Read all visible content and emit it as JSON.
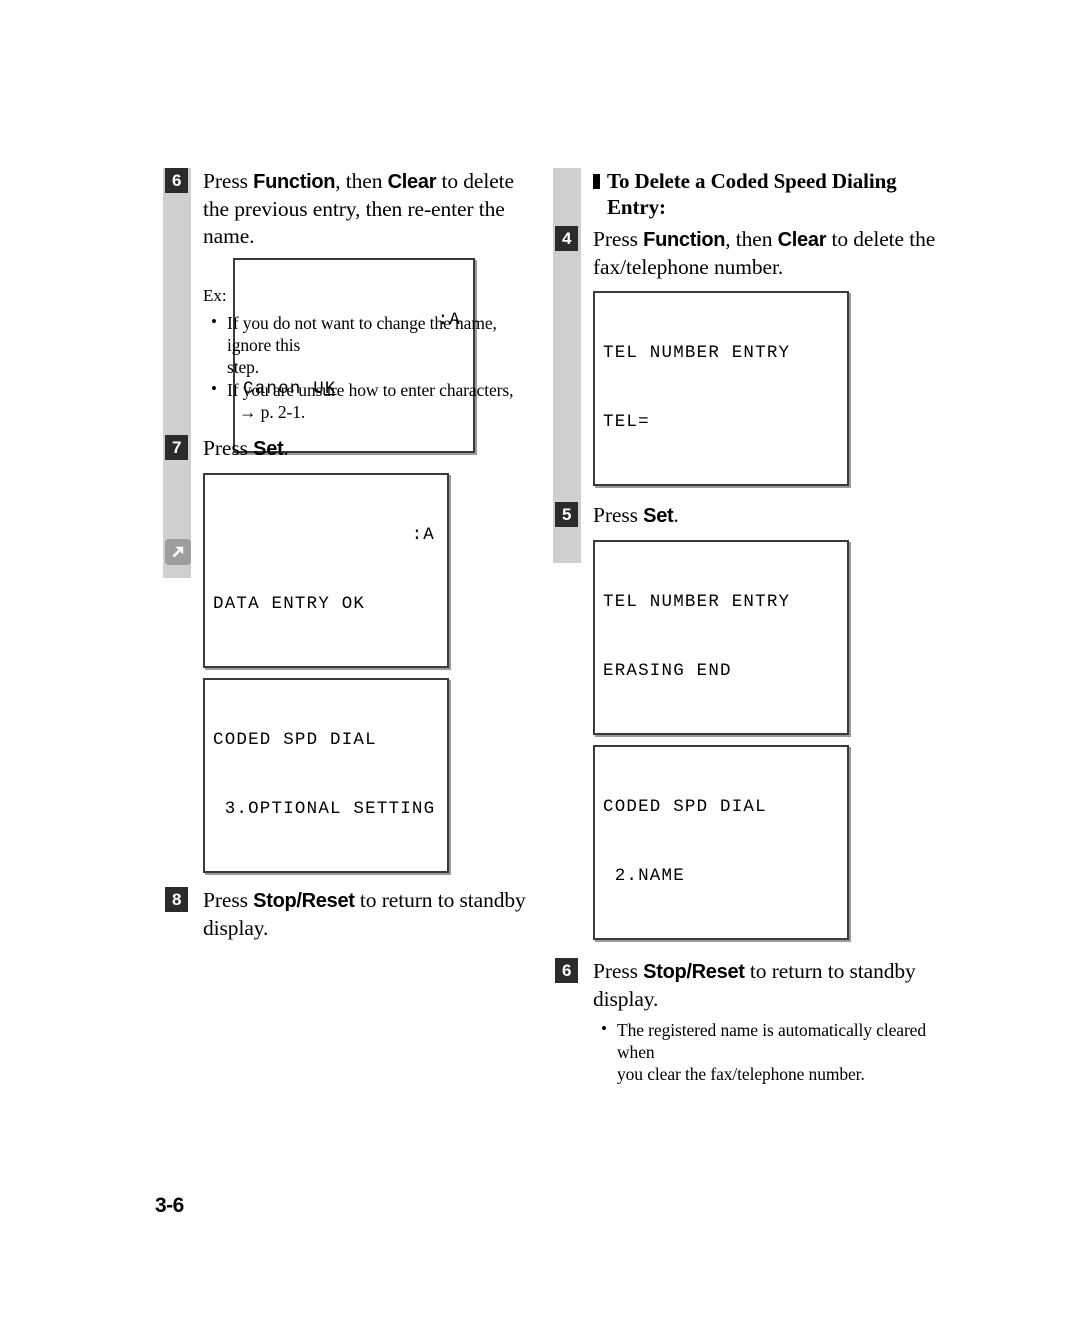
{
  "page": {
    "folio": "3-6"
  },
  "icons": {
    "jump_arrow": "arrow-up-right-icon"
  },
  "left_column": {
    "steps": [
      {
        "number": "6",
        "text_parts": {
          "t1": "Press ",
          "b1": "Function",
          "t2": ", then ",
          "b2": "Clear",
          "t3": " to delete the previous entry, then re-enter the name."
        },
        "example_label": "Ex:",
        "display": {
          "line1_right": ":A",
          "line2_prefix": "Canon U",
          "line2_cursor": "K"
        },
        "bullets": [
          {
            "line1": "If you do not want to change the name, ignore this",
            "line2": "step."
          },
          {
            "line1": "If you are unsure how to enter characters,",
            "line2": "→ p. 2-1."
          }
        ]
      },
      {
        "number": "7",
        "text_parts": {
          "t1": "Press ",
          "b1": "Set",
          "t2": "."
        },
        "display_1": {
          "line1_right": ":A",
          "line2": "DATA ENTRY OK"
        },
        "display_2": {
          "line1": "CODED SPD DIAL",
          "line2": " 3.OPTIONAL SETTING"
        }
      },
      {
        "number": "8",
        "text_parts": {
          "t1": "Press ",
          "b1": "Stop/Reset",
          "t2": " to return to standby display."
        }
      }
    ]
  },
  "right_column": {
    "heading": {
      "line1": "To Delete a Coded Speed Dialing",
      "line2": "Entry:"
    },
    "steps": [
      {
        "number": "4",
        "text_parts": {
          "t1": "Press ",
          "b1": "Function",
          "t2": ", then ",
          "b2": "Clear",
          "t3": " to delete the fax/telephone number."
        },
        "display": {
          "line1": "TEL NUMBER ENTRY",
          "line2": "TEL="
        }
      },
      {
        "number": "5",
        "text_parts": {
          "t1": "Press ",
          "b1": "Set",
          "t2": "."
        },
        "display_1": {
          "line1": "TEL NUMBER ENTRY",
          "line2": "ERASING END"
        },
        "display_2": {
          "line1": "CODED SPD DIAL",
          "line2": " 2.NAME"
        }
      },
      {
        "number": "6",
        "text_parts": {
          "t1": "Press ",
          "b1": "Stop/Reset",
          "t2": " to return to standby display."
        },
        "bullets": [
          {
            "line1": "The registered name is automatically cleared when",
            "line2": "you clear the fax/telephone number."
          }
        ]
      }
    ]
  }
}
